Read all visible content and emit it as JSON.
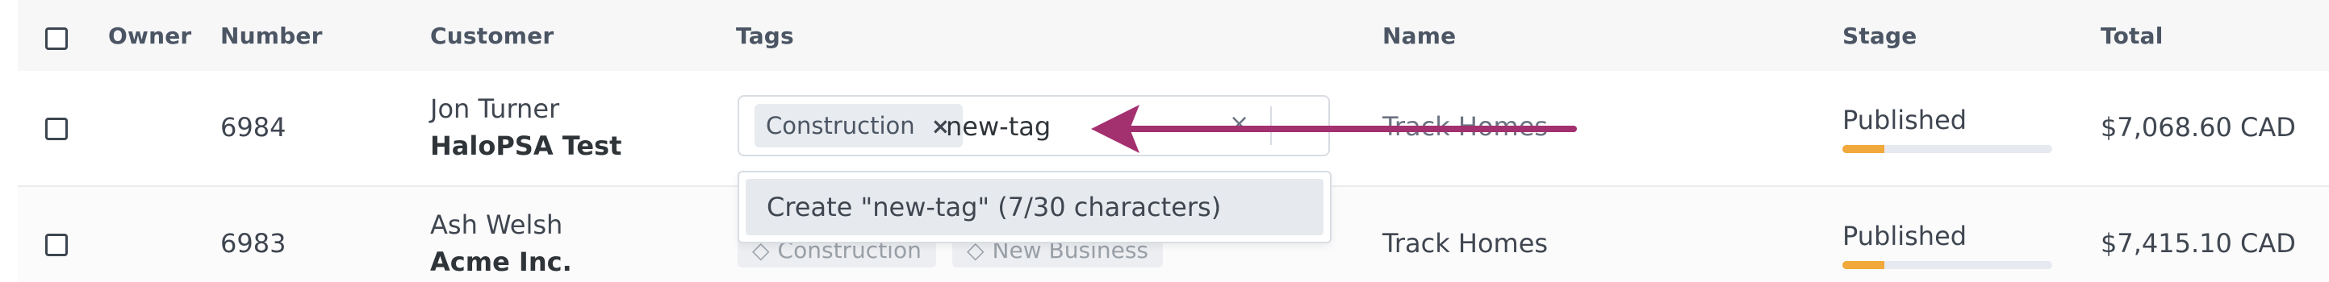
{
  "columns": {
    "owner": "Owner",
    "number": "Number",
    "customer": "Customer",
    "tags": "Tags",
    "name": "Name",
    "stage": "Stage",
    "total": "Total"
  },
  "rows": [
    {
      "number": "6984",
      "contact": "Jon Turner",
      "company": "HaloPSA Test",
      "tags": [
        "Construction"
      ],
      "tag_input_value": "new-tag",
      "name": "Track Homes",
      "stage": "Published",
      "stage_progress": 0.2,
      "total": "$7,068.60 CAD"
    },
    {
      "number": "6983",
      "contact": "Ash Welsh",
      "company": "Acme Inc.",
      "tags": [
        "Construction",
        "New Business"
      ],
      "name": "Track Homes",
      "stage": "Published",
      "stage_progress": 0.2,
      "total": "$7,415.10 CAD"
    }
  ],
  "tag_dropdown": {
    "option": "Create \"new-tag\" (7/30 characters)"
  },
  "colors": {
    "annotation_arrow": "#a3306f",
    "progress_fill": "#f0a93a",
    "progress_track": "#e6e9ef"
  },
  "icons": {
    "tag_remove": "×",
    "clear_input": "×"
  }
}
